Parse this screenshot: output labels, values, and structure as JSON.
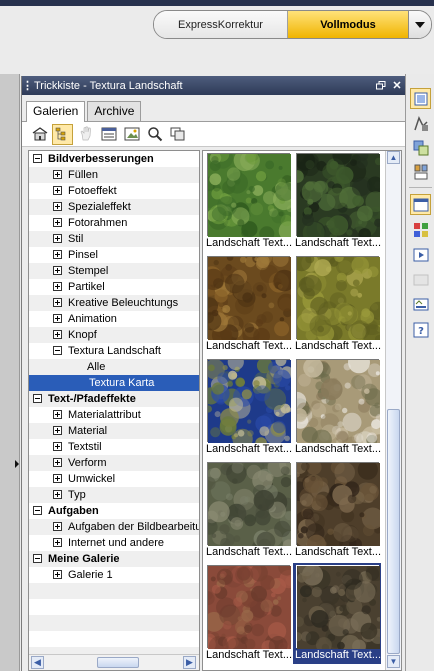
{
  "mode_switch": {
    "express_label": "ExpressKorrektur",
    "full_label": "Vollmodus",
    "dropdown_icon": "chevron-down-icon"
  },
  "panel": {
    "title": "Trickkiste - Textura Landschaft",
    "restore_icon": "restore-icon",
    "close_icon": "close-icon"
  },
  "tabs": [
    {
      "label": "Galerien",
      "active": true
    },
    {
      "label": "Archive",
      "active": false
    }
  ],
  "toolbar": {
    "icons": [
      "home-icon",
      "tree-view-icon",
      "hand-icon",
      "list-icon",
      "image-edit-icon",
      "search-icon",
      "copy-icon"
    ]
  },
  "tree": {
    "items": [
      {
        "label": "Bildverbesserungen",
        "level": 0,
        "toggle": "minus",
        "bold": true
      },
      {
        "label": "Füllen",
        "level": 1,
        "toggle": "plus"
      },
      {
        "label": "Fotoeffekt",
        "level": 1,
        "toggle": "plus"
      },
      {
        "label": "Spezialeffekt",
        "level": 1,
        "toggle": "plus"
      },
      {
        "label": "Fotorahmen",
        "level": 1,
        "toggle": "plus"
      },
      {
        "label": "Stil",
        "level": 1,
        "toggle": "plus"
      },
      {
        "label": "Pinsel",
        "level": 1,
        "toggle": "plus"
      },
      {
        "label": "Stempel",
        "level": 1,
        "toggle": "plus"
      },
      {
        "label": "Partikel",
        "level": 1,
        "toggle": "plus"
      },
      {
        "label": "Kreative Beleuchtungs",
        "level": 1,
        "toggle": "plus"
      },
      {
        "label": "Animation",
        "level": 1,
        "toggle": "plus"
      },
      {
        "label": "Knopf",
        "level": 1,
        "toggle": "plus"
      },
      {
        "label": "Textura Landschaft",
        "level": 1,
        "toggle": "minus"
      },
      {
        "label": "Alle",
        "level": 2,
        "toggle": "none"
      },
      {
        "label": "Textura Karta",
        "level": 2,
        "toggle": "none",
        "selected": true
      },
      {
        "label": "Text-/Pfadeffekte",
        "level": 0,
        "toggle": "minus",
        "bold": true
      },
      {
        "label": "Materialattribut",
        "level": 1,
        "toggle": "plus"
      },
      {
        "label": "Material",
        "level": 1,
        "toggle": "plus"
      },
      {
        "label": "Textstil",
        "level": 1,
        "toggle": "plus"
      },
      {
        "label": "Verform",
        "level": 1,
        "toggle": "plus"
      },
      {
        "label": "Umwickel",
        "level": 1,
        "toggle": "plus"
      },
      {
        "label": "Typ",
        "level": 1,
        "toggle": "plus"
      },
      {
        "label": "Aufgaben",
        "level": 0,
        "toggle": "minus",
        "bold": true
      },
      {
        "label": "Aufgaben der Bildbearbeitu",
        "level": 1,
        "toggle": "plus"
      },
      {
        "label": "Internet und andere",
        "level": 1,
        "toggle": "plus"
      },
      {
        "label": "Meine Galerie",
        "level": 0,
        "toggle": "minus",
        "bold": true
      },
      {
        "label": "Galerie 1",
        "level": 1,
        "toggle": "plus"
      },
      {
        "label": "",
        "level": 0,
        "toggle": "none"
      },
      {
        "label": "",
        "level": 0,
        "toggle": "none"
      },
      {
        "label": "",
        "level": 0,
        "toggle": "none"
      },
      {
        "label": "",
        "level": 0,
        "toggle": "none"
      },
      {
        "label": "",
        "level": 0,
        "toggle": "none"
      }
    ]
  },
  "gallery": {
    "items": [
      {
        "caption": "Landschaft Text...",
        "texture": "grass-green"
      },
      {
        "caption": "Landschaft Text...",
        "texture": "dark-moss"
      },
      {
        "caption": "Landschaft Text...",
        "texture": "brown-earth"
      },
      {
        "caption": "Landschaft Text...",
        "texture": "olive-grass"
      },
      {
        "caption": "Landschaft Text...",
        "texture": "blue-islands"
      },
      {
        "caption": "Landschaft Text...",
        "texture": "sand-snow"
      },
      {
        "caption": "Landschaft Text...",
        "texture": "grey-rock"
      },
      {
        "caption": "Landschaft Text...",
        "texture": "brown-rock"
      },
      {
        "caption": "Landschaft Text...",
        "texture": "red-earth"
      },
      {
        "caption": "Landschaft Text...",
        "texture": "dark-cracked",
        "selected": true
      }
    ]
  },
  "right_toolbar": {
    "icons": [
      "tool-a-icon",
      "tool-b-icon",
      "tool-c-icon",
      "tool-d-icon",
      "tool-e-icon",
      "tool-f-icon",
      "tool-g-icon",
      "tool-h-icon",
      "tool-i-icon",
      "help-icon"
    ]
  },
  "colors": {
    "title_bar": "#3a4766",
    "mode_active": "#f5c400",
    "selection": "#2a5db8"
  }
}
